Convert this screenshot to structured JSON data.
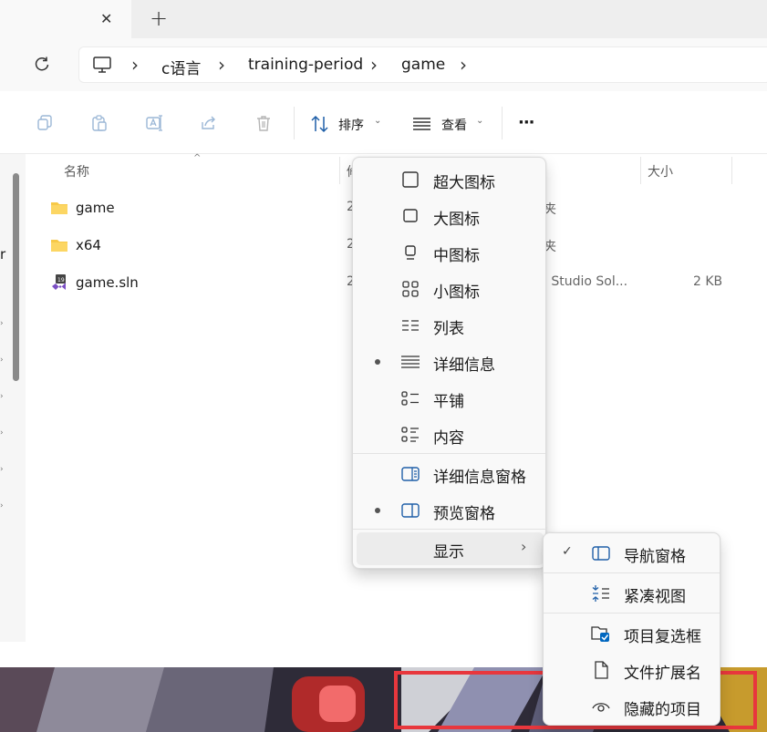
{
  "tabbar": {
    "close_glyph": "✕",
    "add_glyph": "+"
  },
  "addressbar": {
    "refresh_icon": "refresh-icon",
    "computer_icon": "computer-icon",
    "breadcrumbs": [
      "c语言",
      "training-period",
      "game"
    ],
    "separator": "›"
  },
  "toolbar": {
    "sort_label": "排序",
    "view_label": "查看",
    "more_label": "···"
  },
  "columns": {
    "name": "名称",
    "modified": "修",
    "type": "类",
    "size": "大小"
  },
  "files": [
    {
      "name": "game",
      "modified": "2",
      "type": "夹",
      "size": "",
      "kind": "folder"
    },
    {
      "name": "x64",
      "modified": "2",
      "type": "夹",
      "size": "",
      "kind": "folder"
    },
    {
      "name": "game.sln",
      "modified": "2",
      "type": "l Studio Sol...",
      "size": "2 KB",
      "kind": "sln"
    }
  ],
  "view_menu": {
    "items": [
      {
        "label": "超大图标",
        "icon": "extra-large-icons-icon",
        "selected": false
      },
      {
        "label": "大图标",
        "icon": "large-icons-icon",
        "selected": false
      },
      {
        "label": "中图标",
        "icon": "medium-icons-icon",
        "selected": false
      },
      {
        "label": "小图标",
        "icon": "small-icons-icon",
        "selected": false
      },
      {
        "label": "列表",
        "icon": "list-icon",
        "selected": false
      },
      {
        "label": "详细信息",
        "icon": "details-icon",
        "selected": true
      },
      {
        "label": "平铺",
        "icon": "tiles-icon",
        "selected": false
      },
      {
        "label": "内容",
        "icon": "content-icon",
        "selected": false
      }
    ],
    "pane_items": [
      {
        "label": "详细信息窗格",
        "icon": "details-pane-icon",
        "selected": false
      },
      {
        "label": "预览窗格",
        "icon": "preview-pane-icon",
        "selected": true
      }
    ],
    "show_label": "显示"
  },
  "show_submenu": {
    "items": [
      {
        "label": "导航窗格",
        "icon": "navigation-pane-icon",
        "checked": true
      },
      {
        "label": "紧凑视图",
        "icon": "compact-view-icon",
        "checked": false
      },
      {
        "label": "项目复选框",
        "icon": "item-checkbox-icon",
        "checked": false
      },
      {
        "label": "文件扩展名",
        "icon": "file-extension-icon",
        "checked": false
      },
      {
        "label": "隐藏的项目",
        "icon": "hidden-items-icon",
        "checked": false
      }
    ]
  },
  "colors": {
    "accent": "#0067c0",
    "folder": "#f7c948",
    "highlight_box": "#e8373d"
  }
}
